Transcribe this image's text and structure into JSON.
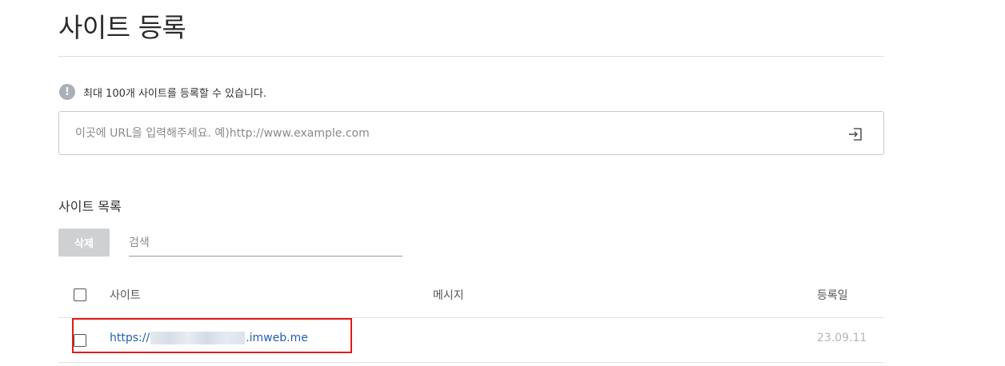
{
  "page": {
    "title": "사이트 등록"
  },
  "notice": {
    "icon": "info-icon",
    "icon_glyph": "!",
    "text": "최대 100개 사이트를 등록할 수 있습니다."
  },
  "url_input": {
    "value": "",
    "placeholder": "이곳에 URL을 입력해주세요. 예)http://www.example.com",
    "submit_icon": "enter-arrow-icon"
  },
  "site_list": {
    "title": "사이트 목록",
    "delete_label": "삭제",
    "search_placeholder": "검색",
    "columns": {
      "site": "사이트",
      "message": "메시지",
      "registered": "등록일"
    },
    "rows": [
      {
        "url_prefix": "https://",
        "url_suffix": ".imweb.me",
        "message": "",
        "date": "23.09.11",
        "checked": false
      }
    ]
  },
  "colors": {
    "accent_link": "#1f5fb0",
    "highlight_box": "#e01a1a",
    "disabled_button": "#cfd0d2"
  }
}
